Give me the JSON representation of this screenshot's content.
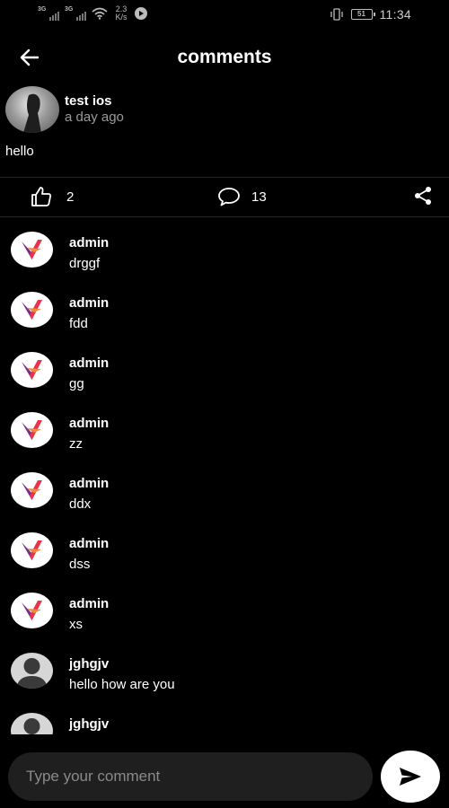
{
  "status_bar": {
    "sim1_net": "3G",
    "sim2_net": "3G",
    "speed_value": "2.3",
    "speed_unit": "K/s",
    "battery": "51",
    "time": "11:34"
  },
  "header": {
    "title": "comments",
    "back_icon": "arrow-left-icon"
  },
  "post": {
    "author": "test ios",
    "time": "a day ago",
    "text": "hello",
    "likes": "2",
    "comments": "13"
  },
  "comments": [
    {
      "name": "admin",
      "text": "drggf",
      "avatar": "brand-v-logo"
    },
    {
      "name": "admin",
      "text": "fdd",
      "avatar": "brand-v-logo"
    },
    {
      "name": "admin",
      "text": "gg",
      "avatar": "brand-v-logo"
    },
    {
      "name": "admin",
      "text": "zz",
      "avatar": "brand-v-logo"
    },
    {
      "name": "admin",
      "text": "ddx",
      "avatar": "brand-v-logo"
    },
    {
      "name": "admin",
      "text": "dss",
      "avatar": "brand-v-logo"
    },
    {
      "name": "admin",
      "text": "xs",
      "avatar": "brand-v-logo"
    },
    {
      "name": "jghgjv",
      "text": "hello how are you",
      "avatar": "default-person"
    },
    {
      "name": "jghgjv",
      "text": "",
      "avatar": "default-person"
    }
  ],
  "composer": {
    "placeholder": "Type your comment",
    "send_icon": "send-icon"
  },
  "colors": {
    "background": "#000000",
    "muted_text": "#9a9a9a",
    "input_bg": "#1f1f1f",
    "logo_red": "#e8334a",
    "logo_purple": "#7b2a8c",
    "logo_orange": "#f08a3c"
  }
}
